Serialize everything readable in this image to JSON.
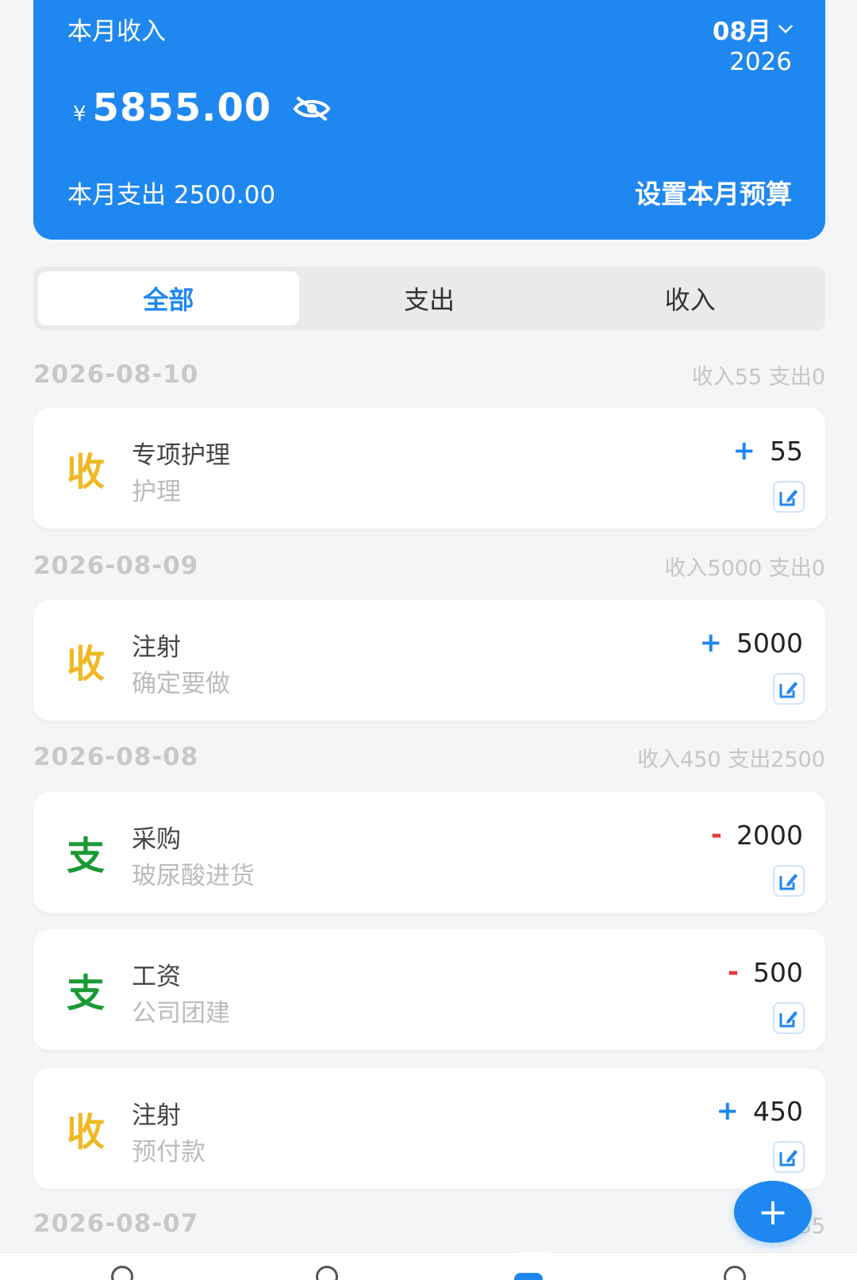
{
  "header": {
    "title": "本月收入",
    "month": "08月",
    "year": "2026",
    "currency": "¥",
    "amount": "5855.00",
    "expense_label": "本月支出 2500.00",
    "budget_button": "设置本月预算",
    "accent_color": "#1f87f0"
  },
  "tabs": [
    {
      "label": "全部",
      "active": true
    },
    {
      "label": "支出",
      "active": false
    },
    {
      "label": "收入",
      "active": false
    }
  ],
  "groups": [
    {
      "date": "2026-08-10",
      "summary": "收入55 支出0",
      "items": [
        {
          "mark": "收",
          "category": "专项护理",
          "note": "护理",
          "sign": "+",
          "amount": "55"
        }
      ]
    },
    {
      "date": "2026-08-09",
      "summary": "收入5000 支出0",
      "items": [
        {
          "mark": "收",
          "category": "注射",
          "note": "确定要做",
          "sign": "+",
          "amount": "5000"
        }
      ]
    },
    {
      "date": "2026-08-08",
      "summary": "收入450 支出2500",
      "items": [
        {
          "mark": "支",
          "category": "采购",
          "note": "玻尿酸进货",
          "sign": "-",
          "amount": "2000"
        },
        {
          "mark": "支",
          "category": "工资",
          "note": "公司团建",
          "sign": "-",
          "amount": "500"
        },
        {
          "mark": "收",
          "category": "注射",
          "note": "预付款",
          "sign": "+",
          "amount": "450"
        }
      ]
    },
    {
      "date": "2026-08-07",
      "summary": "收入35",
      "items": []
    }
  ],
  "fab": {
    "icon": "plus-icon",
    "label": "+"
  },
  "icons": {
    "month_dropdown": "chevron-down-icon",
    "visibility": "eye-off-icon",
    "edit": "edit-icon"
  }
}
